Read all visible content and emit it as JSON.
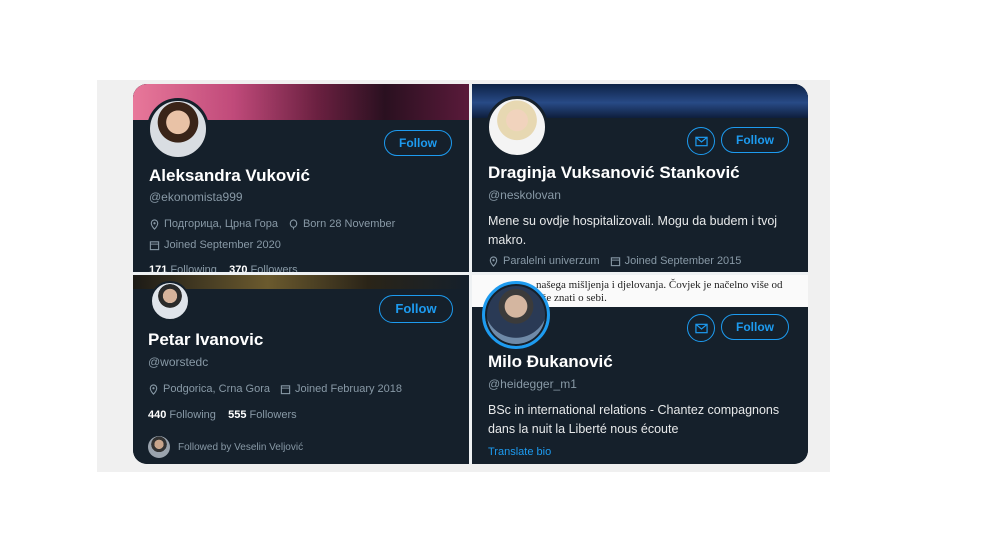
{
  "cards": [
    {
      "name": "Aleksandra Vuković",
      "handle": "@ekonomista999",
      "follow_label": "Follow",
      "location": "Подгорица, Црна Гора",
      "born": "Born 28 November",
      "joined": "Joined September 2020",
      "following_count": "171",
      "following_label": "Following",
      "followers_count": "370",
      "followers_label": "Followers"
    },
    {
      "name": "Draginja Vuksanović Stanković",
      "handle": "@neskolovan",
      "follow_label": "Follow",
      "bio": "Mene su ovdje hospitalizovali. Mogu da budem i tvoj makro.",
      "location": "Paralelni univerzum",
      "joined": "Joined September 2015"
    },
    {
      "name": "Petar Ivanovic",
      "handle": "@worstedc",
      "follow_label": "Follow",
      "location": "Podgorica, Crna Gora",
      "joined": "Joined February 2018",
      "following_count": "440",
      "following_label": "Following",
      "followers_count": "555",
      "followers_label": "Followers",
      "followed_by": "Followed by Veselin Veljović"
    },
    {
      "name": "Milo Đukanović",
      "handle": "@heidegger_m1",
      "follow_label": "Follow",
      "bio": "BSc in international relations - Chantez compagnons dans la nuit la Liberté nous écoute",
      "translate": "Translate bio",
      "banner_text": "našega mišljenja i djelovanja. Čovjek je načelno više od\nože znati o sebi."
    }
  ],
  "colors": {
    "background": "#15202b",
    "accent": "#1d9bf0",
    "secondary_text": "#8899a6"
  },
  "icons": [
    "location-icon",
    "calendar-icon",
    "balloon-icon",
    "mail-icon"
  ]
}
